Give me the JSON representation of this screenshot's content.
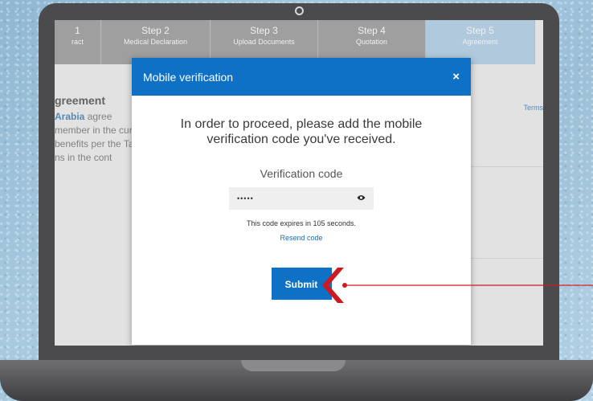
{
  "steps": [
    {
      "title": "1",
      "subtitle": "ract"
    },
    {
      "title": "Step 2",
      "subtitle": "Medical Declaration"
    },
    {
      "title": "Step 3",
      "subtitle": "Upload Documents"
    },
    {
      "title": "Step 4",
      "subtitle": "Quotation"
    },
    {
      "title": "Step 5",
      "subtitle": "Agreement"
    }
  ],
  "background": {
    "heading": "greement",
    "para_highlight": "Arabia",
    "para_rest": "agree member in the cure benefits per the Tab ns in the cont",
    "side_link": "Terms"
  },
  "modal": {
    "title": "Mobile verification",
    "close_label": "×",
    "instruction": "In order to proceed, please add the mobile verification code you've received.",
    "code_label": "Verification code",
    "code_value": "•••••",
    "expiry_text": "This code expires in 105 seconds.",
    "resend_label": "Resend code",
    "submit_label": "Submit"
  },
  "colors": {
    "brand": "#0f71c6",
    "annotation": "#d0191f",
    "active_step": "#bcd6ea"
  },
  "icons": {
    "password_toggle": "eye-icon",
    "close": "close-icon",
    "pointer": "chevron-left-icon"
  }
}
